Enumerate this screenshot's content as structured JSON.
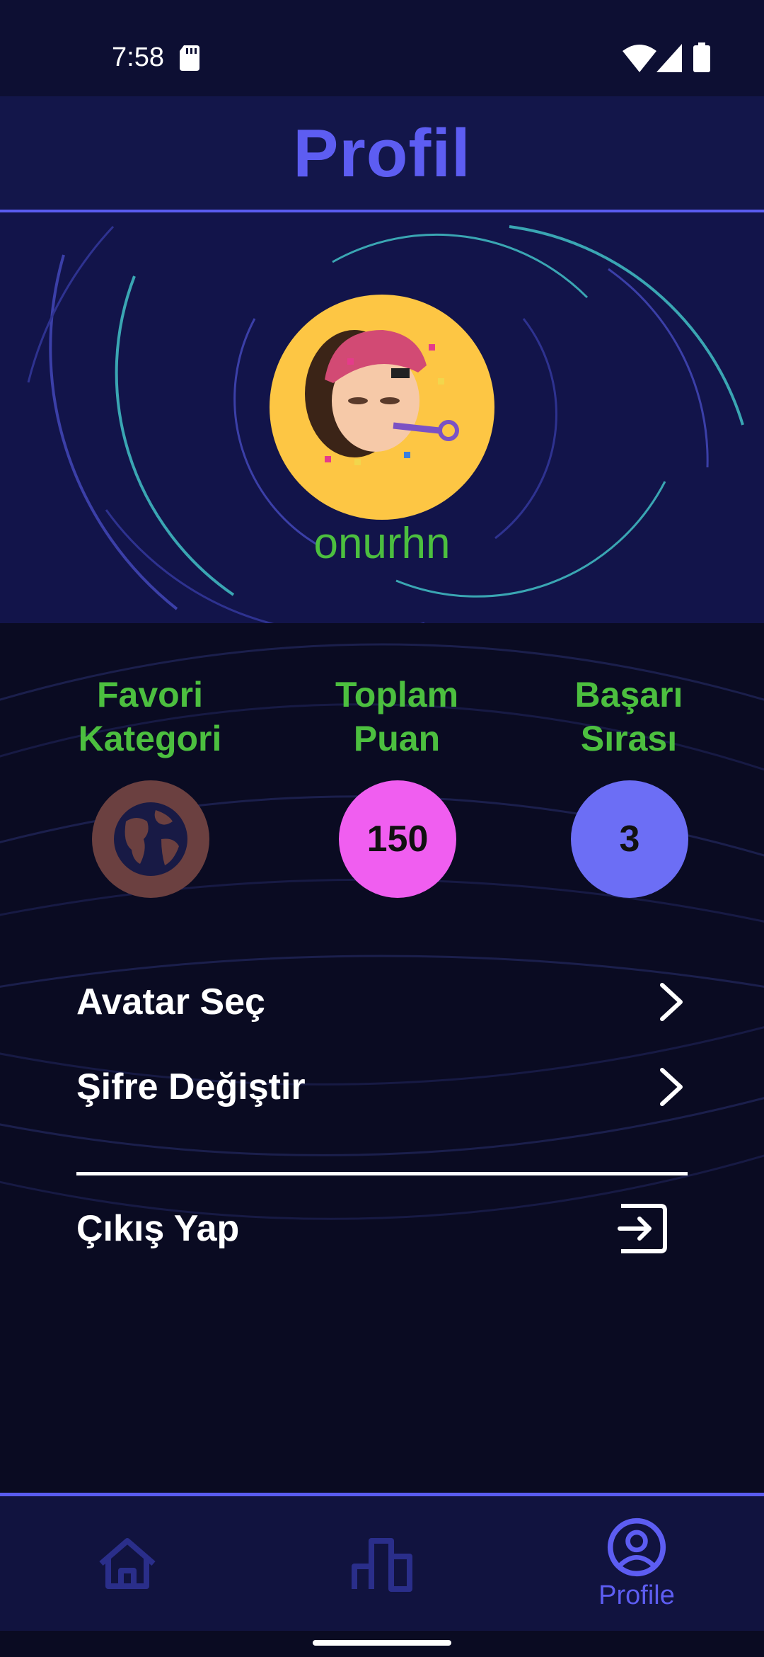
{
  "status_bar": {
    "time": "7:58"
  },
  "header": {
    "title": "Profil"
  },
  "profile": {
    "username": "onurhn"
  },
  "stats": {
    "favorite_category": {
      "label_line1": "Favori",
      "label_line2": "Kategori",
      "icon": "globe-icon"
    },
    "total_points": {
      "label_line1": "Toplam",
      "label_line2": "Puan",
      "value": "150"
    },
    "rank": {
      "label_line1": "Başarı",
      "label_line2": "Sırası",
      "value": "3"
    }
  },
  "menu": {
    "choose_avatar": "Avatar Seç",
    "change_password": "Şifre Değiştir",
    "logout": "Çıkış Yap"
  },
  "bottom_nav": {
    "items": [
      {
        "icon": "home-icon",
        "label": ""
      },
      {
        "icon": "bar-chart-icon",
        "label": ""
      },
      {
        "icon": "account-circle-icon",
        "label": "Profile"
      }
    ]
  },
  "colors": {
    "accent": "#5d5df2",
    "green": "#4cbf3f",
    "avatar_bg": "#fdc644",
    "points": "#f05ef0",
    "rank": "#6c6ef5",
    "category": "#6b4040"
  }
}
